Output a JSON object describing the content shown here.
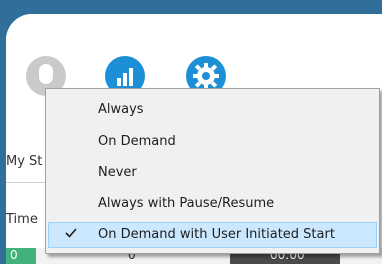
{
  "background": {
    "side_label_status": "My St",
    "side_label_time": "Time",
    "grid_cells": [
      "0",
      "0",
      "00:00"
    ]
  },
  "toolbar": {
    "icons": [
      "user-icon",
      "stats-icon",
      "settings-icon"
    ],
    "accent_color": "#1d8fd6"
  },
  "context_menu": {
    "items": [
      {
        "label": "Always",
        "checked": false
      },
      {
        "label": "On Demand",
        "checked": false
      },
      {
        "label": "Never",
        "checked": false
      },
      {
        "label": "Always with Pause/Resume",
        "checked": false
      },
      {
        "label": "On Demand with User Initiated Start",
        "checked": true
      }
    ],
    "selected_highlight_color": "#cce8ff"
  }
}
